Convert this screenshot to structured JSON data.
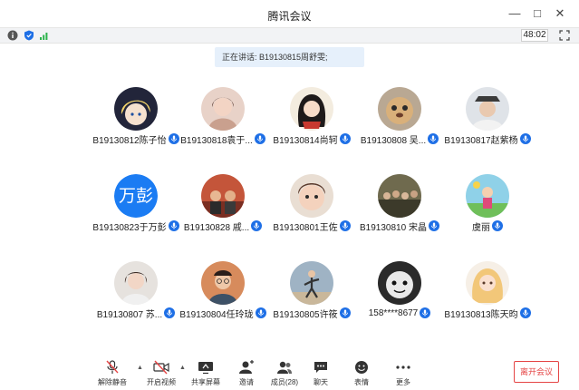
{
  "window": {
    "title": "腾讯会议"
  },
  "infobar": {
    "timer": "48:02"
  },
  "speaking": {
    "text": "正在讲话: B19130815周舒雯;"
  },
  "participants": [
    {
      "name": "B19130812陈子怡",
      "avatar": "anime-girl-dark-icon"
    },
    {
      "name": "B19130818袁于...",
      "avatar": "photo-woman-icon"
    },
    {
      "name": "B19130814尚轲",
      "avatar": "illustration-girl-icon"
    },
    {
      "name": "B19130808 吴...",
      "avatar": "photo-pet-icon"
    },
    {
      "name": "B19130817赵紫杨",
      "avatar": "photo-man-hat-icon"
    },
    {
      "name": "B19130823于万彭",
      "avatar_text": "万彭"
    },
    {
      "name": "B19130828 戚...",
      "avatar": "photo-group-icon"
    },
    {
      "name": "B19130801王佐",
      "avatar": "photo-child-icon"
    },
    {
      "name": "B19130810 宋晶",
      "avatar": "photo-crowd-icon"
    },
    {
      "name": "虞丽",
      "avatar": "cartoon-colorful-icon"
    },
    {
      "name": "B19130807 苏...",
      "avatar": "photo-woman-light-icon"
    },
    {
      "name": "B19130804任玲珑",
      "avatar": "photo-man-glasses-icon"
    },
    {
      "name": "B19130805许筱",
      "avatar": "photo-runner-icon"
    },
    {
      "name": "158****8677",
      "avatar": "photo-toy-face-icon"
    },
    {
      "name": "B19130813陈天昀",
      "avatar": "cartoon-blonde-girl-icon"
    }
  ],
  "toolbar": {
    "unmute": "解除静音",
    "video": "开启视频",
    "share": "共享屏幕",
    "invite": "邀请",
    "members": "成员(28)",
    "chat": "聊天",
    "emoji": "表情",
    "more": "更多",
    "leave": "离开会议"
  },
  "colors": {
    "accent": "#1e6fe6",
    "leave": "#e54545",
    "speaking_bg": "#e6f0fb"
  }
}
